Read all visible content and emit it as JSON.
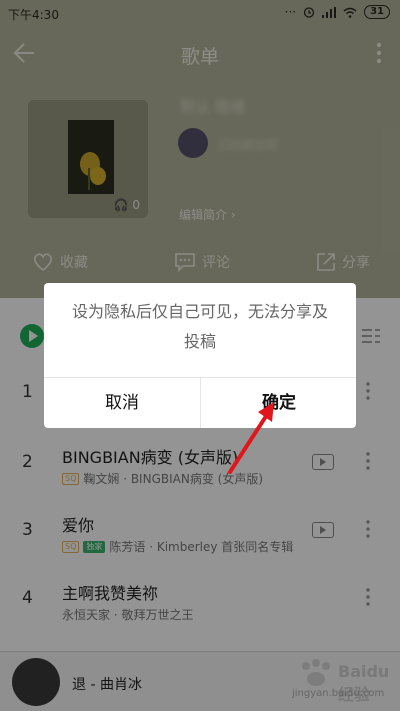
{
  "status_bar": {
    "time": "下午4:30",
    "battery": "31"
  },
  "toolbar": {
    "title": "歌单"
  },
  "playlist": {
    "play_count": "0",
    "edit_intro": "编辑简介 ›",
    "name_blurred": "默认 情绪",
    "creator_blurred": "已经被加密"
  },
  "actions": {
    "favorite": "收藏",
    "comment": "评论",
    "share": "分享"
  },
  "songs": [
    {
      "index": "1",
      "title": "",
      "artist": "",
      "tags": []
    },
    {
      "index": "2",
      "title": "BINGBIAN病变 (女声版)",
      "artist": "鞠文娴 · BINGBIAN病变 (女声版)",
      "tags": [
        "SQ"
      ]
    },
    {
      "index": "3",
      "title": "爱你",
      "artist": "陈芳语 · Kimberley 首张同名专辑",
      "tags": [
        "SQ",
        "独家"
      ]
    },
    {
      "index": "4",
      "title": "主啊我赞美祢",
      "artist": "永恒天家 · 敬拜万世之王",
      "tags": []
    }
  ],
  "mini_player": {
    "title": "退 - 曲肖冰"
  },
  "watermark": {
    "brand": "Baidu 经验",
    "url": "jingyan.baidu.com"
  },
  "dialog": {
    "message": "设为隐私后仅自己可见，无法分享及投稿",
    "cancel_label": "取消",
    "confirm_label": "确定"
  },
  "colors": {
    "accent": "#21b05a",
    "header_bg": "#b4b49c",
    "arrow": "#e0161c"
  }
}
